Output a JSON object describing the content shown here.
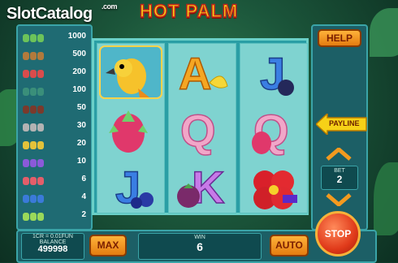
{
  "site_logo": {
    "text": "SlotCatalog",
    "suffix": ".com"
  },
  "game_title": "HOT PALM",
  "paytable": [
    {
      "value": "1000"
    },
    {
      "value": "500"
    },
    {
      "value": "200"
    },
    {
      "value": "100"
    },
    {
      "value": "50"
    },
    {
      "value": "30"
    },
    {
      "value": "20"
    },
    {
      "value": "10"
    },
    {
      "value": "6"
    },
    {
      "value": "4"
    },
    {
      "value": "2"
    }
  ],
  "paytable_colors": [
    "#6cc35a",
    "#b27a3c",
    "#d94c4c",
    "#3a8f7a",
    "#7a3a2c",
    "#b3b3b3",
    "#e3c23a",
    "#8a5ad9",
    "#e35e6a",
    "#3a7ad9",
    "#9ad95a"
  ],
  "reels": [
    [
      "parrot",
      "dragonfruit",
      "letter-j"
    ],
    [
      "letter-a-banana",
      "letter-q",
      "letter-k-mangosteen"
    ],
    [
      "letter-j-passionfruit",
      "letter-q-dragonfruit",
      "hibiscus"
    ]
  ],
  "buttons": {
    "help": "HELP",
    "payline": "PAYLINE",
    "max": "MAX",
    "auto": "AUTO",
    "stop": "STOP"
  },
  "bet": {
    "label": "BET",
    "value": "2"
  },
  "info": {
    "cr_line": "1CR = 0.01FUN",
    "balance_label": "BALANCE",
    "balance_value": "499998"
  },
  "win": {
    "label": "WIN",
    "value": "6"
  },
  "colors": {
    "accent_orange": "#f39a1f",
    "panel": "#1c5f66",
    "title_yellow": "#f6d117"
  }
}
